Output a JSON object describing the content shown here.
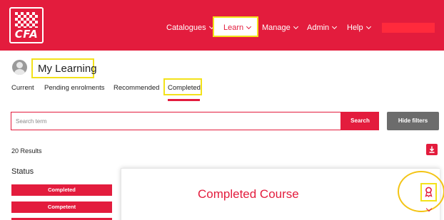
{
  "header": {
    "logo_text": "CFA",
    "nav": [
      {
        "label": "Catalogues"
      },
      {
        "label": "Learn"
      },
      {
        "label": "Manage"
      },
      {
        "label": "Admin"
      },
      {
        "label": "Help"
      }
    ],
    "brand_color": "#e31c3d",
    "highlight_color": "#f3e21a"
  },
  "page": {
    "title": "My Learning",
    "tabs": [
      {
        "label": "Current"
      },
      {
        "label": "Pending enrolments"
      },
      {
        "label": "Recommended"
      },
      {
        "label": "Completed",
        "active": true
      }
    ]
  },
  "search": {
    "placeholder": "Search term",
    "value": "",
    "button_label": "Search",
    "hide_filters_label": "Hide filters"
  },
  "results": {
    "count_text": "20 Results"
  },
  "filters": {
    "heading": "Status",
    "options": [
      {
        "label": "Completed"
      },
      {
        "label": "Competent"
      },
      {
        "label": ""
      }
    ]
  },
  "card": {
    "title": "Completed Course"
  },
  "icons": [
    "cfa-logo",
    "chevron-down-icon",
    "avatar-icon",
    "download-icon",
    "award-icon"
  ]
}
